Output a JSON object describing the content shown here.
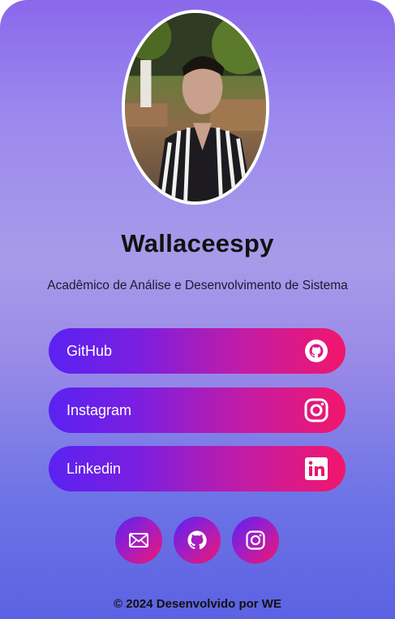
{
  "profile": {
    "name": "Wallaceespy",
    "subtitle": "Acadêmico de Análise e Desenvolvimento de Sistema"
  },
  "links": [
    {
      "label": "GitHub",
      "icon": "github-icon"
    },
    {
      "label": "Instagram",
      "icon": "instagram-icon"
    },
    {
      "label": "Linkedin",
      "icon": "linkedin-icon"
    }
  ],
  "social": [
    {
      "icon": "email-icon"
    },
    {
      "icon": "github-icon"
    },
    {
      "icon": "instagram-icon"
    }
  ],
  "footer": {
    "text": "© 2024 Desenvolvido por WE"
  },
  "colors": {
    "gradient_start": "#5a22f2",
    "gradient_end": "#f2166b",
    "background_top": "#8a68ea",
    "background_bottom": "#5c62e2"
  }
}
